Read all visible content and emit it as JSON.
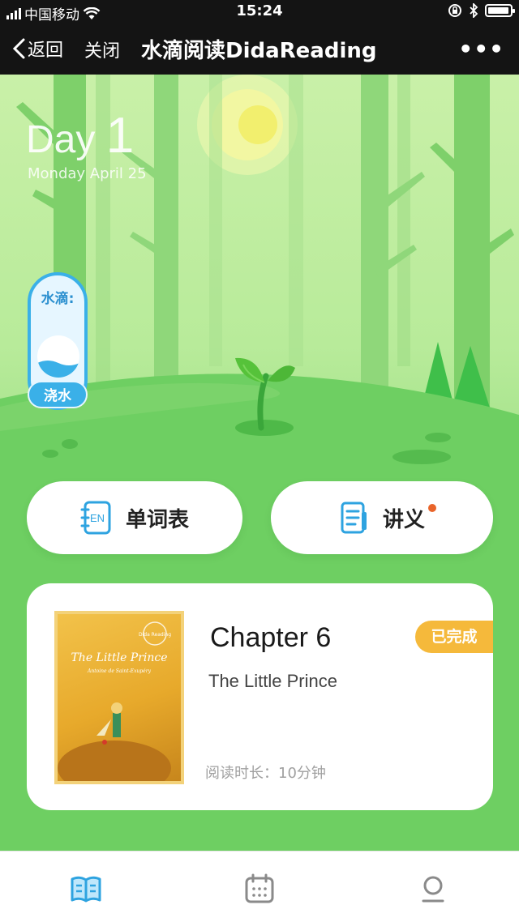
{
  "status_bar": {
    "carrier": "中国移动",
    "time": "15:24",
    "battery_level": 0.95
  },
  "nav": {
    "back_label": "返回",
    "close_label": "关闭",
    "title": "水滴阅读DidaReading",
    "more_label": "•••"
  },
  "hero": {
    "day_prefix": "Day",
    "day_number": "1",
    "date": "Monday  April 25"
  },
  "drop": {
    "label": "水滴:",
    "water_button": "浇水"
  },
  "actions": {
    "words": {
      "icon_text": "EN",
      "label": "单词表"
    },
    "notes": {
      "label": "讲义",
      "has_dot": true
    }
  },
  "chapter_card": {
    "chapter": "Chapter 6",
    "book": "The Little Prince",
    "read_time": "阅读时长：10分钟",
    "status": "已完成",
    "cover_title": "The Little Prince",
    "cover_author": "Antoine de Saint-Exupéry",
    "cover_stamp": "Dida Reading"
  },
  "tabs": [
    {
      "name": "reading",
      "icon": "book-icon",
      "active": true
    },
    {
      "name": "calendar",
      "icon": "calendar-icon",
      "active": false
    },
    {
      "name": "profile",
      "icon": "person-icon",
      "active": false
    }
  ],
  "colors": {
    "accent_blue": "#3ab0e8",
    "badge_orange": "#f5b93b",
    "dot_orange": "#e9642a",
    "grass": "#6ecf62"
  }
}
